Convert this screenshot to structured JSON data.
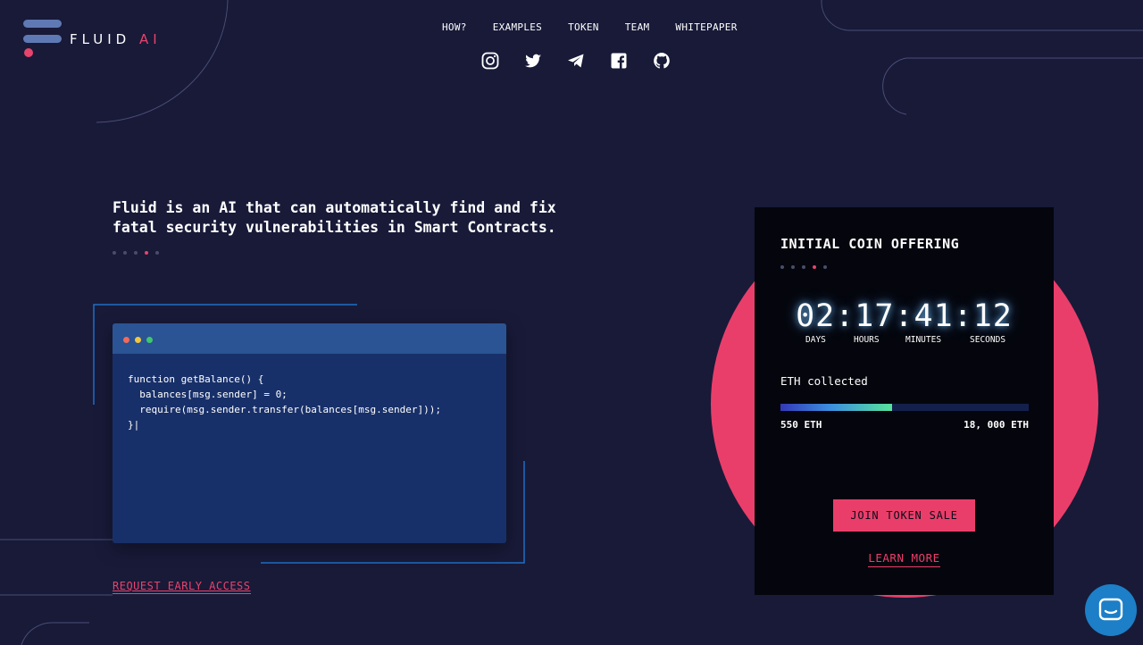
{
  "brand": {
    "name_main": "FLUID",
    "name_accent": "AI"
  },
  "nav": {
    "items": [
      "HOW?",
      "EXAMPLES",
      "TOKEN",
      "TEAM",
      "WHITEPAPER"
    ]
  },
  "socials": [
    "instagram-icon",
    "twitter-icon",
    "telegram-icon",
    "facebook-icon",
    "github-icon"
  ],
  "hero": {
    "headline_line1": "Fluid is an AI that can automatically find and fix",
    "headline_line2": "fatal security vulnerabilities in Smart Contracts.",
    "slide_count": 5,
    "active_slide": 4
  },
  "code": {
    "line1": "function getBalance() {",
    "line2": "",
    "line3": "  balances[msg.sender] = 0;",
    "line4": "  require(msg.sender.transfer(balances[msg.sender]));",
    "line5": "",
    "line6": "}|"
  },
  "cta": {
    "request_access": "REQUEST EARLY ACCESS"
  },
  "ico": {
    "title": "INITIAL COIN OFFERING",
    "countdown": "02:17:41:12",
    "labels": {
      "days": "DAYS",
      "hours": "HOURS",
      "minutes": "MINUTES",
      "seconds": "SECONDS"
    },
    "eth_label": "ETH collected",
    "progress_fraction": 0.45,
    "progress_min": "550 ETH",
    "progress_max": "18, 000 ETH",
    "join_button": "JOIN TOKEN SALE",
    "learn_more": "LEARN MORE"
  },
  "colors": {
    "background": "#181a38",
    "accent": "#ea3e6a",
    "code_bg": "#183069",
    "code_bar": "#2a5494",
    "card_bg": "#05060d",
    "chat": "#1c7fc7"
  }
}
